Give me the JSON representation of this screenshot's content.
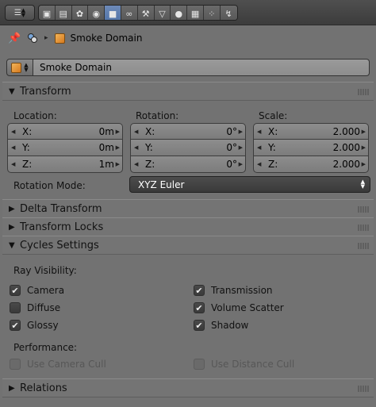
{
  "header": {
    "tabs": [
      {
        "name": "render",
        "glyph": "▣"
      },
      {
        "name": "render-layers",
        "glyph": "▤"
      },
      {
        "name": "scene",
        "glyph": "✿"
      },
      {
        "name": "world",
        "glyph": "◉"
      },
      {
        "name": "object",
        "glyph": "■",
        "active": true
      },
      {
        "name": "constraints",
        "glyph": "∞"
      },
      {
        "name": "modifiers",
        "glyph": "⚒"
      },
      {
        "name": "data",
        "glyph": "▽"
      },
      {
        "name": "material",
        "glyph": "●"
      },
      {
        "name": "texture",
        "glyph": "▦"
      },
      {
        "name": "particles",
        "glyph": "⁘"
      },
      {
        "name": "physics",
        "glyph": "↯"
      }
    ]
  },
  "breadcrumb": {
    "object_name": "Smoke Domain"
  },
  "object": {
    "name": "Smoke Domain"
  },
  "transform": {
    "title": "Transform",
    "location_label": "Location:",
    "rotation_label": "Rotation:",
    "scale_label": "Scale:",
    "location": [
      {
        "axis": "X:",
        "value": "0m"
      },
      {
        "axis": "Y:",
        "value": "0m"
      },
      {
        "axis": "Z:",
        "value": "1m"
      }
    ],
    "rotation": [
      {
        "axis": "X:",
        "value": "0°"
      },
      {
        "axis": "Y:",
        "value": "0°"
      },
      {
        "axis": "Z:",
        "value": "0°"
      }
    ],
    "scale": [
      {
        "axis": "X:",
        "value": "2.000"
      },
      {
        "axis": "Y:",
        "value": "2.000"
      },
      {
        "axis": "Z:",
        "value": "2.000"
      }
    ],
    "rotation_mode_label": "Rotation Mode:",
    "rotation_mode_value": "XYZ Euler"
  },
  "delta_transform": {
    "title": "Delta Transform"
  },
  "transform_locks": {
    "title": "Transform Locks"
  },
  "cycles": {
    "title": "Cycles Settings",
    "ray_visibility_label": "Ray Visibility:",
    "camera": {
      "label": "Camera",
      "checked": true
    },
    "diffuse": {
      "label": "Diffuse",
      "checked": false
    },
    "glossy": {
      "label": "Glossy",
      "checked": true
    },
    "transmission": {
      "label": "Transmission",
      "checked": true
    },
    "volume_scatter": {
      "label": "Volume Scatter",
      "checked": true
    },
    "shadow": {
      "label": "Shadow",
      "checked": true
    },
    "performance_label": "Performance:",
    "camera_cull": {
      "label": "Use Camera Cull",
      "checked": false
    },
    "distance_cull": {
      "label": "Use Distance Cull",
      "checked": false
    }
  },
  "relations": {
    "title": "Relations"
  },
  "colors": {
    "background": "#727272",
    "active_tab": "#5274a8",
    "object_icon": "#e39a3c"
  }
}
